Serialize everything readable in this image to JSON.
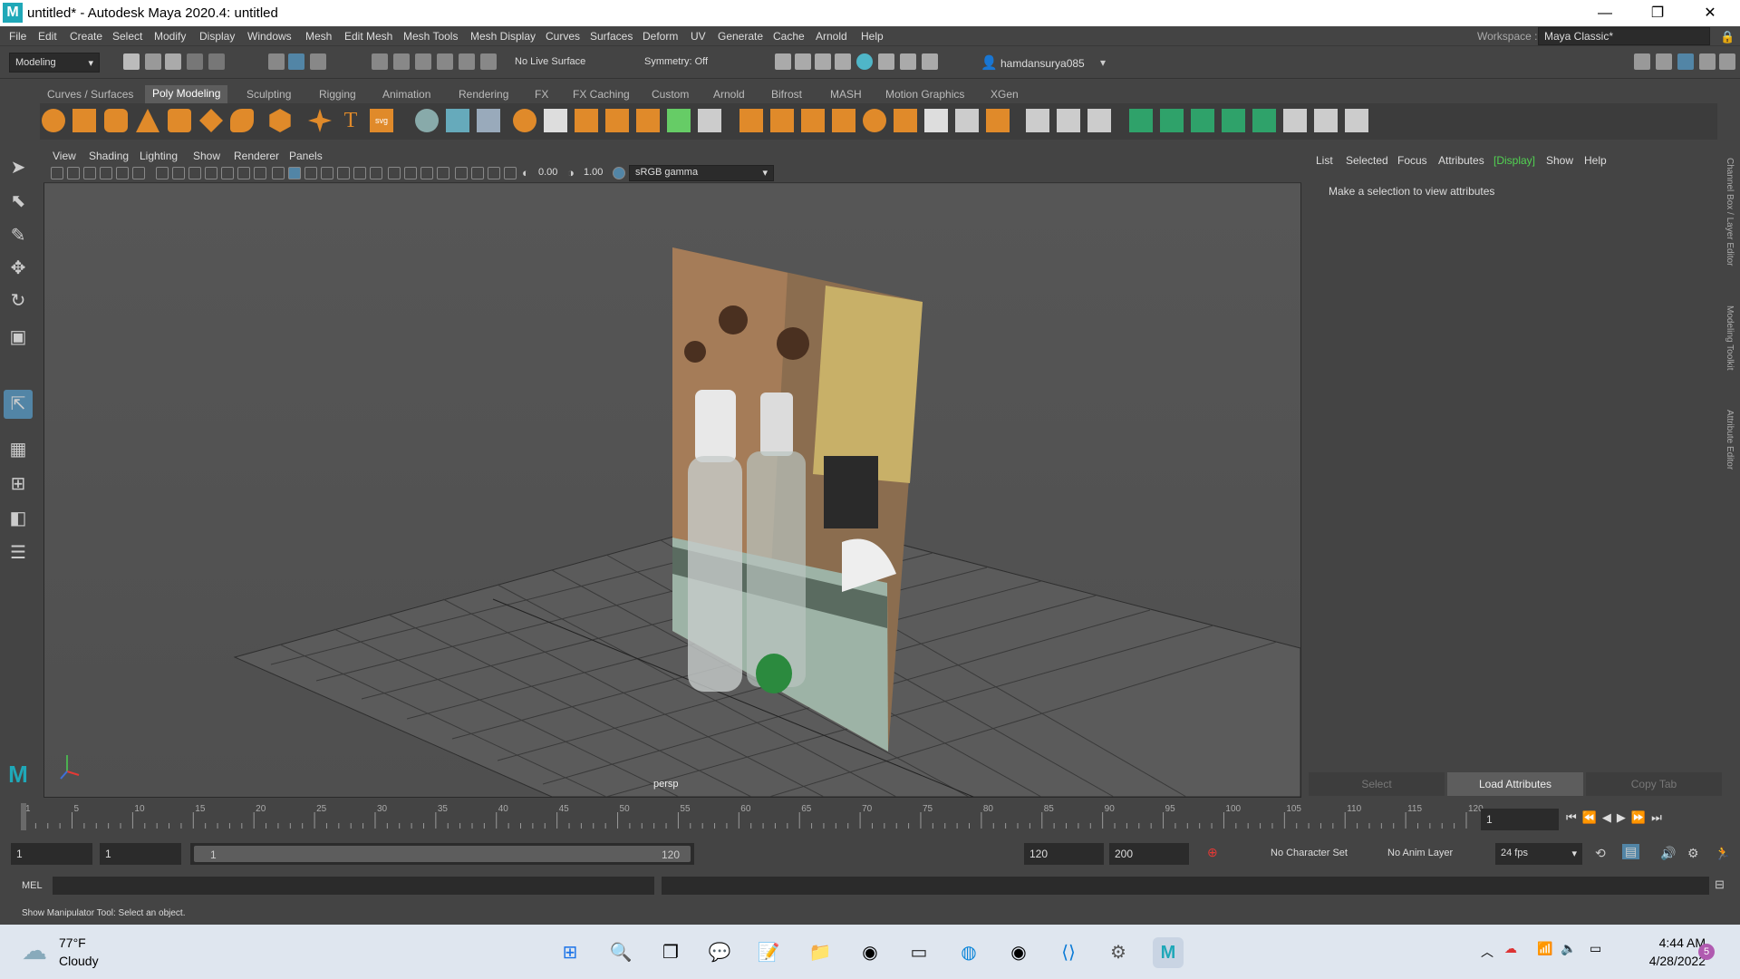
{
  "window": {
    "title": "untitled* - Autodesk Maya 2020.4: untitled",
    "logo": "M",
    "minimize": "—",
    "maximize": "❐",
    "close": "✕"
  },
  "menu": [
    "File",
    "Edit",
    "Create",
    "Select",
    "Modify",
    "Display",
    "Windows",
    "Mesh",
    "Edit Mesh",
    "Mesh Tools",
    "Mesh Display",
    "Curves",
    "Surfaces",
    "Deform",
    "UV",
    "Generate",
    "Cache",
    "Arnold",
    "Help"
  ],
  "workspace": {
    "label": "Workspace :",
    "value": "Maya Classic*"
  },
  "status": {
    "menuset": "Modeling",
    "live_surface": "No Live Surface",
    "symmetry": "Symmetry: Off",
    "user": "hamdansurya085"
  },
  "shelf_tabs": [
    "Curves / Surfaces",
    "Poly Modeling",
    "Sculpting",
    "Rigging",
    "Animation",
    "Rendering",
    "FX",
    "FX Caching",
    "Custom",
    "Arnold",
    "Bifrost",
    "MASH",
    "Motion Graphics",
    "XGen"
  ],
  "shelf_active": "Poly Modeling",
  "viewport": {
    "menu": [
      "View",
      "Shading",
      "Lighting",
      "Show",
      "Renderer",
      "Panels"
    ],
    "exposure": "0.00",
    "gamma": "1.00",
    "colorspace": "sRGB gamma",
    "camera_label": "persp"
  },
  "attr_editor": {
    "tabs": [
      "List",
      "Selected",
      "Focus",
      "Attributes",
      "[Display]",
      "Show",
      "Help"
    ],
    "message": "Make a selection to view attributes",
    "buttons": [
      "Select",
      "Load Attributes",
      "Copy Tab"
    ]
  },
  "side_tabs": [
    "Channel Box / Layer Editor",
    "Modeling Toolkit",
    "Attribute Editor"
  ],
  "timeline": {
    "ticks": [
      "1",
      "5",
      "10",
      "15",
      "20",
      "25",
      "30",
      "35",
      "40",
      "45",
      "50",
      "55",
      "60",
      "65",
      "70",
      "75",
      "80",
      "85",
      "90",
      "95",
      "100",
      "105",
      "110",
      "115",
      "120"
    ],
    "current_frame": "1"
  },
  "range": {
    "start": "1",
    "start_inner": "1",
    "slider_start": "1",
    "slider_end": "120",
    "end": "120",
    "end_outer": "200",
    "character_set": "No Character Set",
    "anim_layer": "No Anim Layer",
    "fps": "24 fps"
  },
  "cmd": {
    "label": "MEL"
  },
  "help_line": "Show Manipulator Tool: Select an object.",
  "taskbar": {
    "temp": "77°F",
    "weather": "Cloudy",
    "time": "4:44 AM",
    "date": "4/28/2022",
    "notif": "5"
  },
  "colors": {
    "accent": "#5285a6",
    "display_tab": "#52d352",
    "bg": "#444444"
  }
}
